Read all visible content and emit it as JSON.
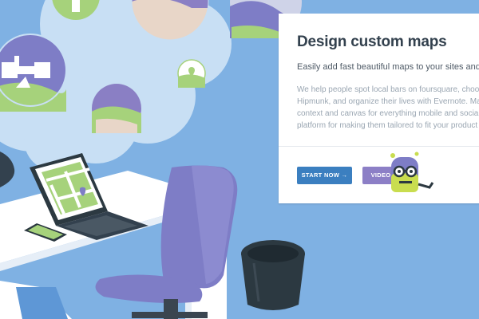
{
  "card": {
    "title": "Design custom maps",
    "subtitle": "Easily add fast beautiful maps to your sites and apps",
    "body_lines": [
      "We help people spot local bars on foursquare, choos",
      "Hipmunk, and organize their lives with Evernote. Map",
      "context and canvas for everything mobile and social,",
      "platform for making them tailored to fit your product"
    ],
    "start_button": "START NOW →",
    "video_button": "VIDEO"
  },
  "icons": {
    "satellite": "satellite-icon",
    "map_pin": "map-pin-icon",
    "mascot": "robot-mascot-icon"
  },
  "colors": {
    "background": "#7fb1e3",
    "cloud": "#c8dff4",
    "start_button": "#3b7fc0",
    "video_button": "#8c7fc6",
    "chair": "#7e7dc6",
    "desk": "#ffffff",
    "trash_can": "#2c3941",
    "map_green": "#a6d27b",
    "title_text": "#33414e"
  }
}
